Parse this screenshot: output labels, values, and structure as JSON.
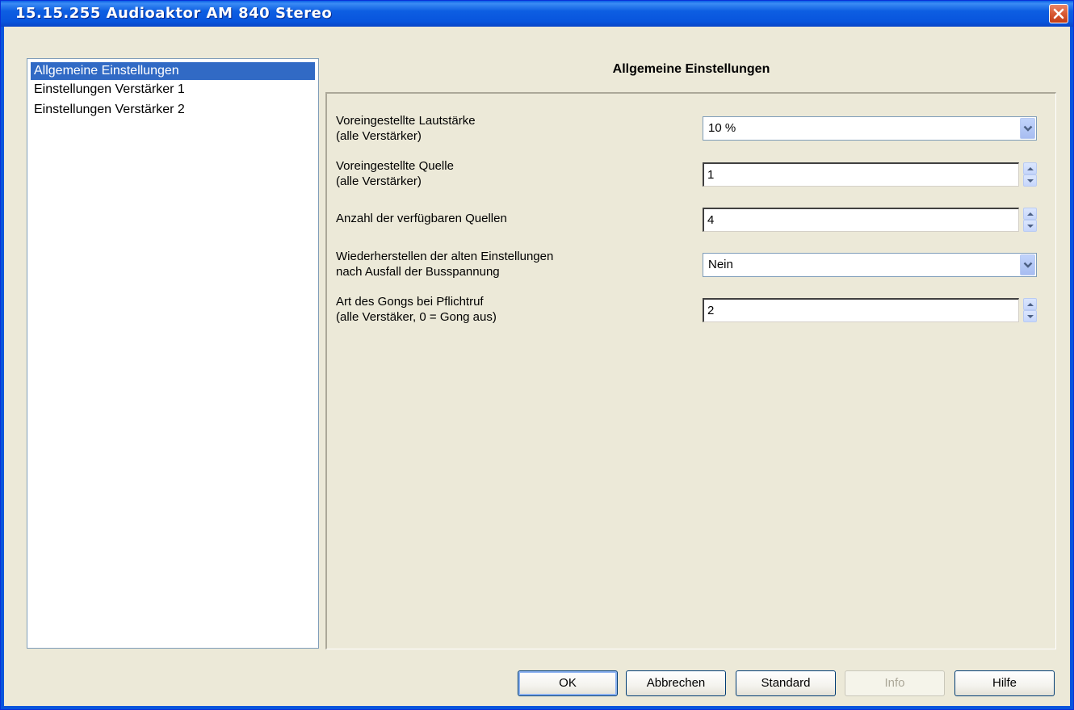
{
  "window": {
    "title": "15.15.255 Audioaktor AM 840 Stereo"
  },
  "tree": {
    "items": [
      {
        "label": "Allgemeine Einstellungen",
        "selected": true
      },
      {
        "label": "Einstellungen Verstärker 1",
        "selected": false
      },
      {
        "label": "Einstellungen Verstärker 2",
        "selected": false
      }
    ]
  },
  "panel": {
    "title": "Allgemeine Einstellungen",
    "params": [
      {
        "label_line1": "Voreingestellte Lautstärke",
        "label_line2": "(alle Verstärker)",
        "control": "dropdown",
        "value": "10 %"
      },
      {
        "label_line1": "Voreingestellte Quelle",
        "label_line2": "(alle Verstärker)",
        "control": "spinbox",
        "value": "1"
      },
      {
        "label_line1": "Anzahl der verfügbaren Quellen",
        "label_line2": "",
        "control": "spinbox",
        "value": "4"
      },
      {
        "label_line1": "Wiederherstellen der alten Einstellungen",
        "label_line2": "nach Ausfall der Busspannung",
        "control": "dropdown",
        "value": "Nein"
      },
      {
        "label_line1": "Art des Gongs bei Pflichtruf",
        "label_line2": "(alle Verstäker, 0 = Gong aus)",
        "control": "spinbox",
        "value": "2"
      }
    ]
  },
  "buttons": {
    "ok": "OK",
    "cancel": "Abbrechen",
    "standard": "Standard",
    "info": "Info",
    "help": "Hilfe"
  },
  "icons": {
    "close": "close-icon",
    "dropdown": "chevron-down-icon",
    "spin_up": "spin-up-icon",
    "spin_down": "spin-down-icon"
  },
  "colors": {
    "titlebar": "#0855dd",
    "selection": "#316ac5",
    "face": "#ece9d8"
  }
}
